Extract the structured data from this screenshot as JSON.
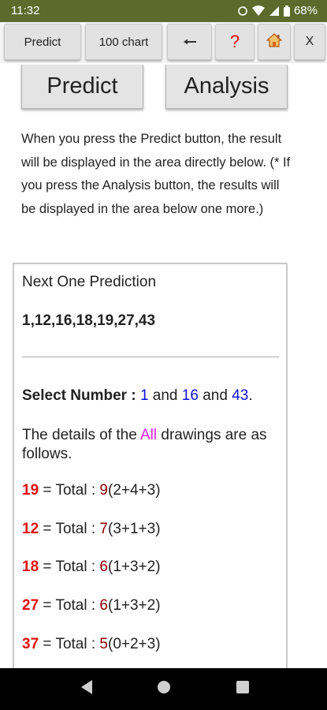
{
  "status_bar": {
    "time": "11:32",
    "battery": "68%"
  },
  "toolbar": {
    "predict_label": "Predict",
    "chart_label": "100 chart",
    "back_label": "⟵",
    "help_label": "?",
    "home_label": "🏠",
    "close_label": "X"
  },
  "actions": {
    "predict_label": "Predict",
    "analysis_label": "Analysis"
  },
  "description": "When you press the Predict button, the result will be displayed in the area directly below. (* If you press the Analysis button, the results will be displayed in the area below one more.)",
  "result": {
    "heading": "Next One Prediction",
    "numbers": "1,12,16,18,19,27,43",
    "select_label": "Select Number : ",
    "select_n1": "1",
    "and1": " and ",
    "select_n2": "16",
    "and2": " and ",
    "select_n3": "43",
    "period": ".",
    "details_prefix": "The details of the ",
    "details_highlight": "All",
    "details_suffix": " drawings are as follows.",
    "rows": [
      {
        "num": "19",
        "mid": " = Total : ",
        "total": "9",
        "detail": "(2+4+3)"
      },
      {
        "num": "12",
        "mid": " = Total : ",
        "total": "7",
        "detail": "(3+1+3)"
      },
      {
        "num": "18",
        "mid": " = Total : ",
        "total": "6",
        "detail": "(1+3+2)"
      },
      {
        "num": "27",
        "mid": " = Total : ",
        "total": "6",
        "detail": "(1+3+2)"
      },
      {
        "num": "37",
        "mid": " = Total : ",
        "total": "5",
        "detail": "(0+2+3)"
      }
    ]
  },
  "colors": {
    "status_bar": "#5e6a2c",
    "prediction_red": "#e01010",
    "select_blue": "#1010d8",
    "all_magenta": "#e020e0",
    "total_darkred": "#8b0000"
  }
}
